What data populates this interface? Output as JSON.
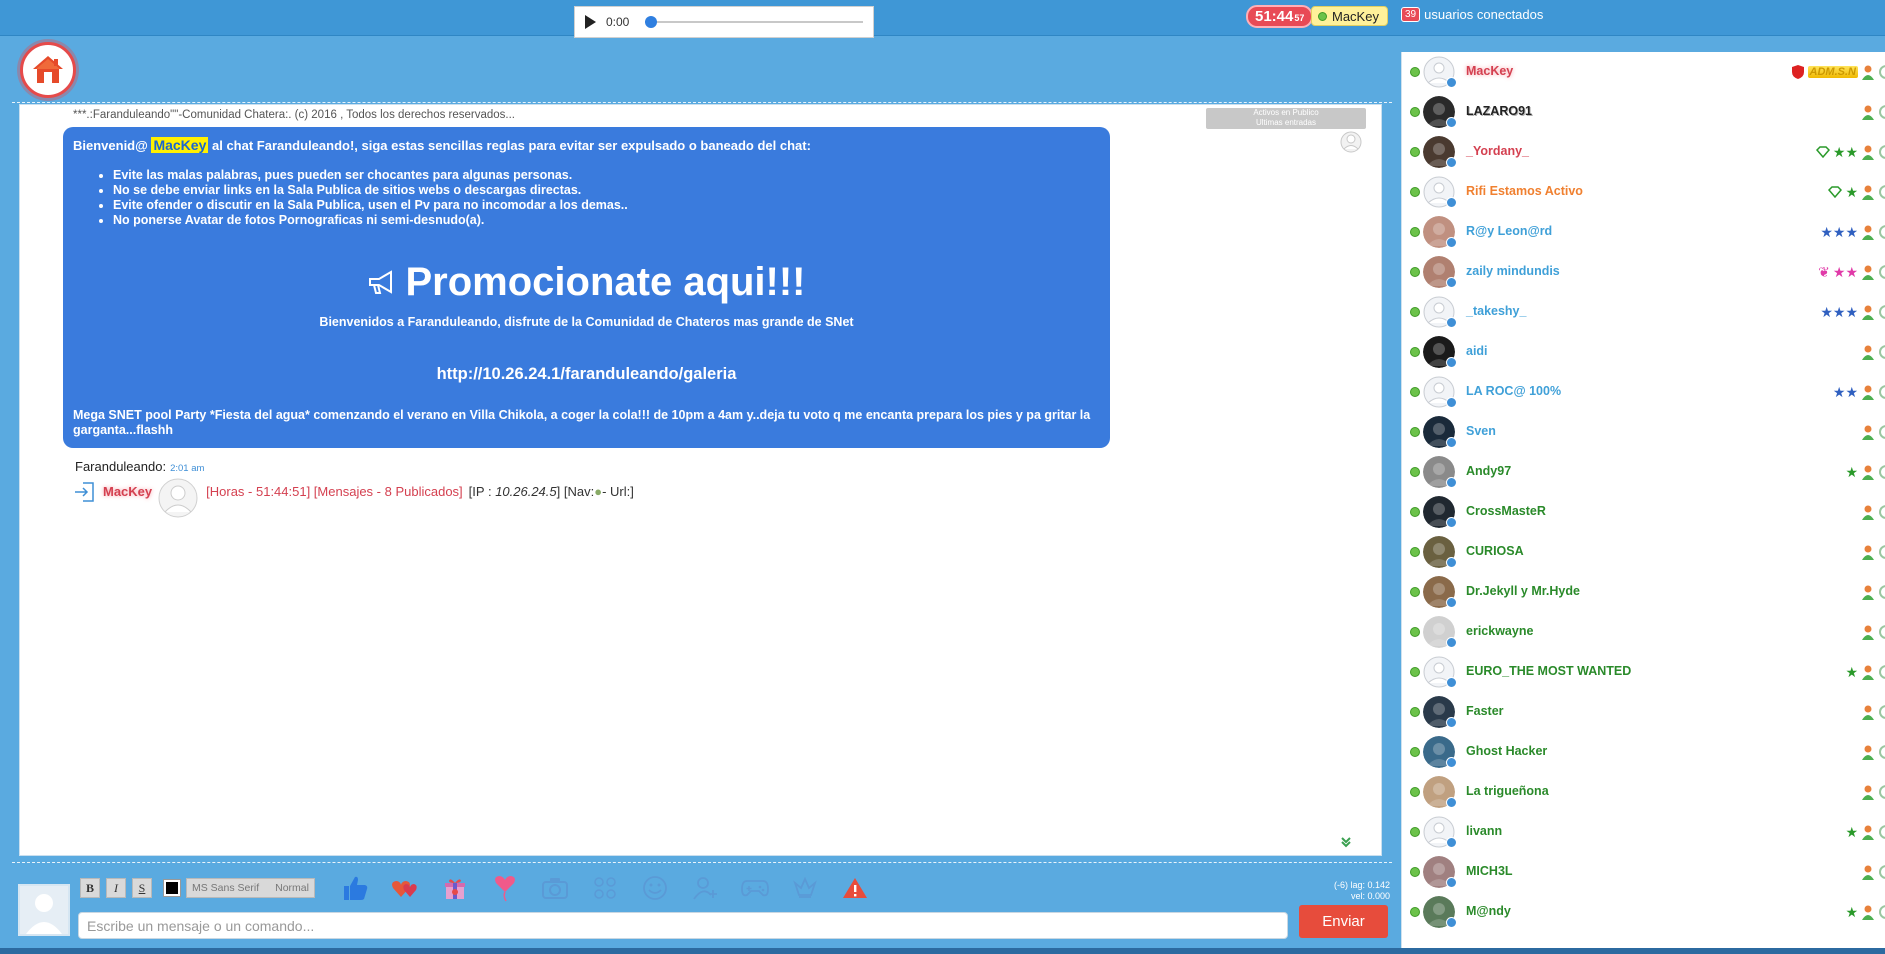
{
  "player": {
    "time": "0:00",
    "progress": 0
  },
  "timer": {
    "main": "51:44",
    "sec": "57"
  },
  "current_user": "MacKey",
  "online": {
    "count": "39",
    "label": "usuarios conectados"
  },
  "chat": {
    "copyright": "***.:Faranduleando\"\"-Comunidad Chatera:. (c) 2016 , Todos los derechos reservados...",
    "room_tabs": [
      "Activos en Publico",
      "Ultimas entradas"
    ],
    "welcome": {
      "greet_prefix": "Bienvenid@",
      "greet_user": "MacKey",
      "greet_suffix": "al chat Faranduleando!, siga estas sencillas reglas para evitar ser expulsado o baneado del chat:",
      "rules": [
        "Evite las malas palabras, pues pueden ser chocantes para algunas personas.",
        "No se debe enviar links en la Sala Publica de sitios webs o descargas directas.",
        "Evite ofender o discutir en la Sala Publica, usen el Pv para no incomodar a los demas..",
        "No ponerse Avatar de fotos Pornograficas ni semi-desnudo(a)."
      ],
      "promo_title": "Promocionate aqui!!!",
      "promo_sub": "Bienvenidos a Faranduleando, disfrute de la Comunidad de Chateros mas grande de SNet",
      "link": "http://10.26.24.1/faranduleando/galeria",
      "party_line1": "Mega SNET pool Party *Fiesta del agua* comenzando el verano en Villa Chikola, a coger la cola!!! de 10pm a 4am y..deja tu voto q me encanta prepara los pies y pa gritar la",
      "party_line2": "garganta...flashh"
    },
    "sender": {
      "name": "Faranduleando:",
      "time": "2:01 am"
    },
    "join": {
      "user": "MacKey",
      "info": "[Horas - 51:44:51] [Mensajes - 8 Publicados]",
      "ip_label": "[IP :",
      "ip": "10.26.24.5",
      "nav_open": "] [Nav:",
      "url": "- Url:]"
    }
  },
  "composer": {
    "bold": "B",
    "italic": "I",
    "underline": "S",
    "font": "MS Sans Serif",
    "size": "Normal",
    "placeholder": "Escribe un mensaje o un comando...",
    "send": "Enviar",
    "lag_line1": "(-6) lag: 0.142",
    "lag_line2": "vel: 0.000"
  },
  "users": [
    {
      "name": "MacKey",
      "color": "#d44050",
      "glow": true,
      "admin": true,
      "admin_text": "ADM.S.N",
      "stars": "",
      "star_color": "",
      "gem": ""
    },
    {
      "name": "LAZARO91",
      "color": "#222222",
      "glow": false,
      "stars": "",
      "star_color": "",
      "gem": ""
    },
    {
      "name": "_Yordany_",
      "color": "#d44050",
      "glow": false,
      "stars": "★★",
      "star_color": "#2a9a2a",
      "gem": "#2a9a2a"
    },
    {
      "name": "Rifi Estamos Activo",
      "color": "#f08030",
      "glow": false,
      "stars": "★",
      "star_color": "#2a9a2a",
      "gem": "#2a9a2a"
    },
    {
      "name": "R@y Leon@rd",
      "color": "#3fa0d8",
      "glow": false,
      "stars": "★★★",
      "star_color": "#3060c0",
      "gem": ""
    },
    {
      "name": "zaily mindundis",
      "color": "#3fa0d8",
      "glow": false,
      "stars": "★★",
      "star_color": "#e03aa8",
      "gem": "",
      "butterfly": true
    },
    {
      "name": "_takeshy_",
      "color": "#3fa0d8",
      "glow": false,
      "stars": "★★★",
      "star_color": "#3060c0",
      "gem": ""
    },
    {
      "name": "aidi",
      "color": "#3fa0d8",
      "glow": false,
      "stars": "",
      "star_color": "",
      "gem": ""
    },
    {
      "name": "LA ROC@ 100%",
      "color": "#3fa0d8",
      "glow": false,
      "stars": "★★",
      "star_color": "#3060c0",
      "gem": ""
    },
    {
      "name": "Sven",
      "color": "#3fa0d8",
      "glow": false,
      "stars": "",
      "star_color": "",
      "gem": ""
    },
    {
      "name": "Andy97",
      "color": "#2a8a2a",
      "glow": false,
      "stars": "★",
      "star_color": "#2a9a2a",
      "gem": ""
    },
    {
      "name": "CrossMasteR",
      "color": "#2a8a2a",
      "glow": false,
      "stars": "",
      "star_color": "",
      "gem": ""
    },
    {
      "name": "CURIOSA",
      "color": "#2a8a2a",
      "glow": false,
      "stars": "",
      "star_color": "",
      "gem": ""
    },
    {
      "name": "Dr.Jekyll y Mr.Hyde",
      "color": "#2a8a2a",
      "glow": false,
      "stars": "",
      "star_color": "",
      "gem": ""
    },
    {
      "name": "erickwayne",
      "color": "#2a8a2a",
      "glow": false,
      "stars": "",
      "star_color": "",
      "gem": ""
    },
    {
      "name": "EURO_THE MOST WANTED",
      "color": "#2a8a2a",
      "glow": false,
      "stars": "★",
      "star_color": "#2a9a2a",
      "gem": ""
    },
    {
      "name": "Faster",
      "color": "#2a8a2a",
      "glow": false,
      "stars": "",
      "star_color": "",
      "gem": ""
    },
    {
      "name": "Ghost Hacker",
      "color": "#2a8a2a",
      "glow": false,
      "stars": "",
      "star_color": "",
      "gem": ""
    },
    {
      "name": "La trigueñona",
      "color": "#2a8a2a",
      "glow": false,
      "stars": "",
      "star_color": "",
      "gem": ""
    },
    {
      "name": "livann",
      "color": "#2a8a2a",
      "glow": false,
      "stars": "★",
      "star_color": "#2a9a2a",
      "gem": ""
    },
    {
      "name": "MICH3L",
      "color": "#2a8a2a",
      "glow": false,
      "stars": "",
      "star_color": "",
      "gem": ""
    },
    {
      "name": "M@ndy",
      "color": "#2a8a2a",
      "glow": false,
      "stars": "★",
      "star_color": "#2a9a2a",
      "gem": ""
    }
  ]
}
